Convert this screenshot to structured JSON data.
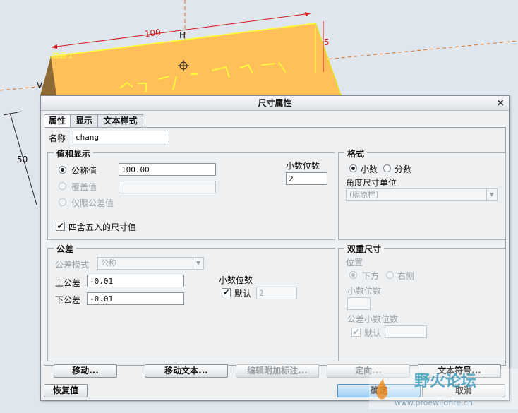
{
  "cad": {
    "dim_top": "100",
    "label_h": "H",
    "label_v": "V",
    "dim_left": "50",
    "dim_right": "5",
    "surface_label": "曲面 1"
  },
  "dialog": {
    "title": "尺寸属性",
    "close": "×",
    "tabs": [
      "属性",
      "显示",
      "文本样式"
    ],
    "name_label": "名称",
    "name_value": "chang",
    "value_group": {
      "title": "值和显示",
      "nominal_label": "公称值",
      "nominal_value": "100.00",
      "override_label": "覆盖值",
      "override_value": "",
      "tolerance_only_label": "仅限公差值",
      "decimals_label": "小数位数",
      "decimals_value": "2",
      "round_label": "四舍五入的尺寸值",
      "round_checked": true
    },
    "format_group": {
      "title": "格式",
      "decimal_label": "小数",
      "fraction_label": "分数",
      "angle_unit_label": "角度尺寸单位",
      "angle_unit_value": "(照原样)"
    },
    "tolerance_group": {
      "title": "公差",
      "mode_label": "公差模式",
      "mode_value": "公称",
      "upper_label": "上公差",
      "upper_value": "-0.01",
      "lower_label": "下公差",
      "lower_value": "-0.01",
      "decimals_label": "小数位数",
      "default_label": "默认",
      "default_value": "2"
    },
    "dual_group": {
      "title": "双重尺寸",
      "position_label": "位置",
      "below_label": "下方",
      "right_label": "右侧",
      "decimals_label": "小数位数",
      "decimals_value": "",
      "tol_decimals_label": "公差小数位数",
      "default_label": "默认",
      "default_value": ""
    },
    "buttons": {
      "move": "移动...",
      "move_text": "移动文本...",
      "edit_attached": "编辑附加标注...",
      "orient": "定向...",
      "text_symbol": "文本符号...",
      "restore": "恢复值",
      "ok": "确定",
      "cancel": "取消"
    }
  },
  "watermark": {
    "title": "野火论坛",
    "url": "www.proewildfire.cn"
  },
  "colors": {
    "part_fill": "#ffc05a",
    "dim_red": "#d01818",
    "edge_yellow": "#ffff3a",
    "primary_button": "#9ecff5"
  }
}
